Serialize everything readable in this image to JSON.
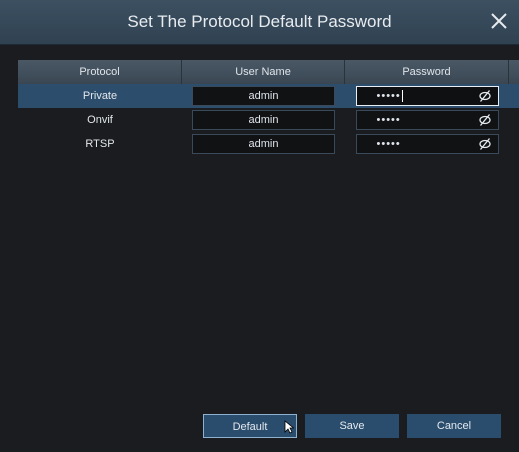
{
  "dialog": {
    "title": "Set The Protocol Default Password"
  },
  "table": {
    "columns": [
      "Protocol",
      "User Name",
      "Password"
    ],
    "rows": [
      {
        "protocol": "Private",
        "user": "admin",
        "password": "•••••",
        "selected": true
      },
      {
        "protocol": "Onvif",
        "user": "admin",
        "password": "•••••",
        "selected": false
      },
      {
        "protocol": "RTSP",
        "user": "admin",
        "password": "•••••",
        "selected": false
      }
    ]
  },
  "buttons": {
    "default": "Default",
    "save": "Save",
    "cancel": "Cancel"
  },
  "icons": {
    "close": "close-icon",
    "password_visibility": "eye-off-icon"
  },
  "colors": {
    "titlebar": "#34495a",
    "selected_row": "#2c4d6b",
    "button": "#2b4d6d"
  }
}
